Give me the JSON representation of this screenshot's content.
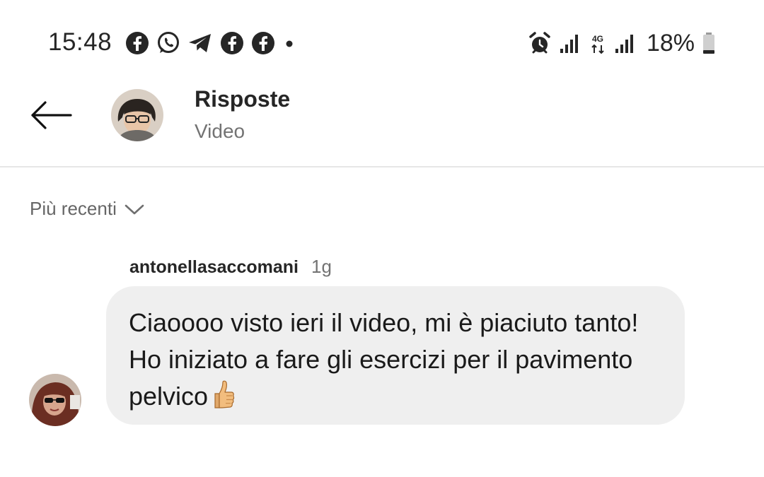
{
  "status_bar": {
    "time": "15:48",
    "notification_icons": [
      "facebook-icon",
      "whatsapp-icon",
      "telegram-icon",
      "facebook-icon",
      "facebook-icon",
      "dot-icon"
    ],
    "network_label": "4G",
    "battery": "18%"
  },
  "header": {
    "title": "Risposte",
    "subtitle": "Video"
  },
  "sort": {
    "label": "Più recenti"
  },
  "comment": {
    "username": "antonellasaccomani",
    "time": "1g",
    "text": "Ciaoooo visto ieri il video, mi è piaciuto tanto! Ho iniziato a fare gli esercizi per il pavimento pelvico",
    "emoji": "thumbs-up-icon"
  },
  "colors": {
    "bubble_bg": "#efefef",
    "text_primary": "#262626",
    "text_secondary": "#737373",
    "divider": "#e6e6e6"
  }
}
